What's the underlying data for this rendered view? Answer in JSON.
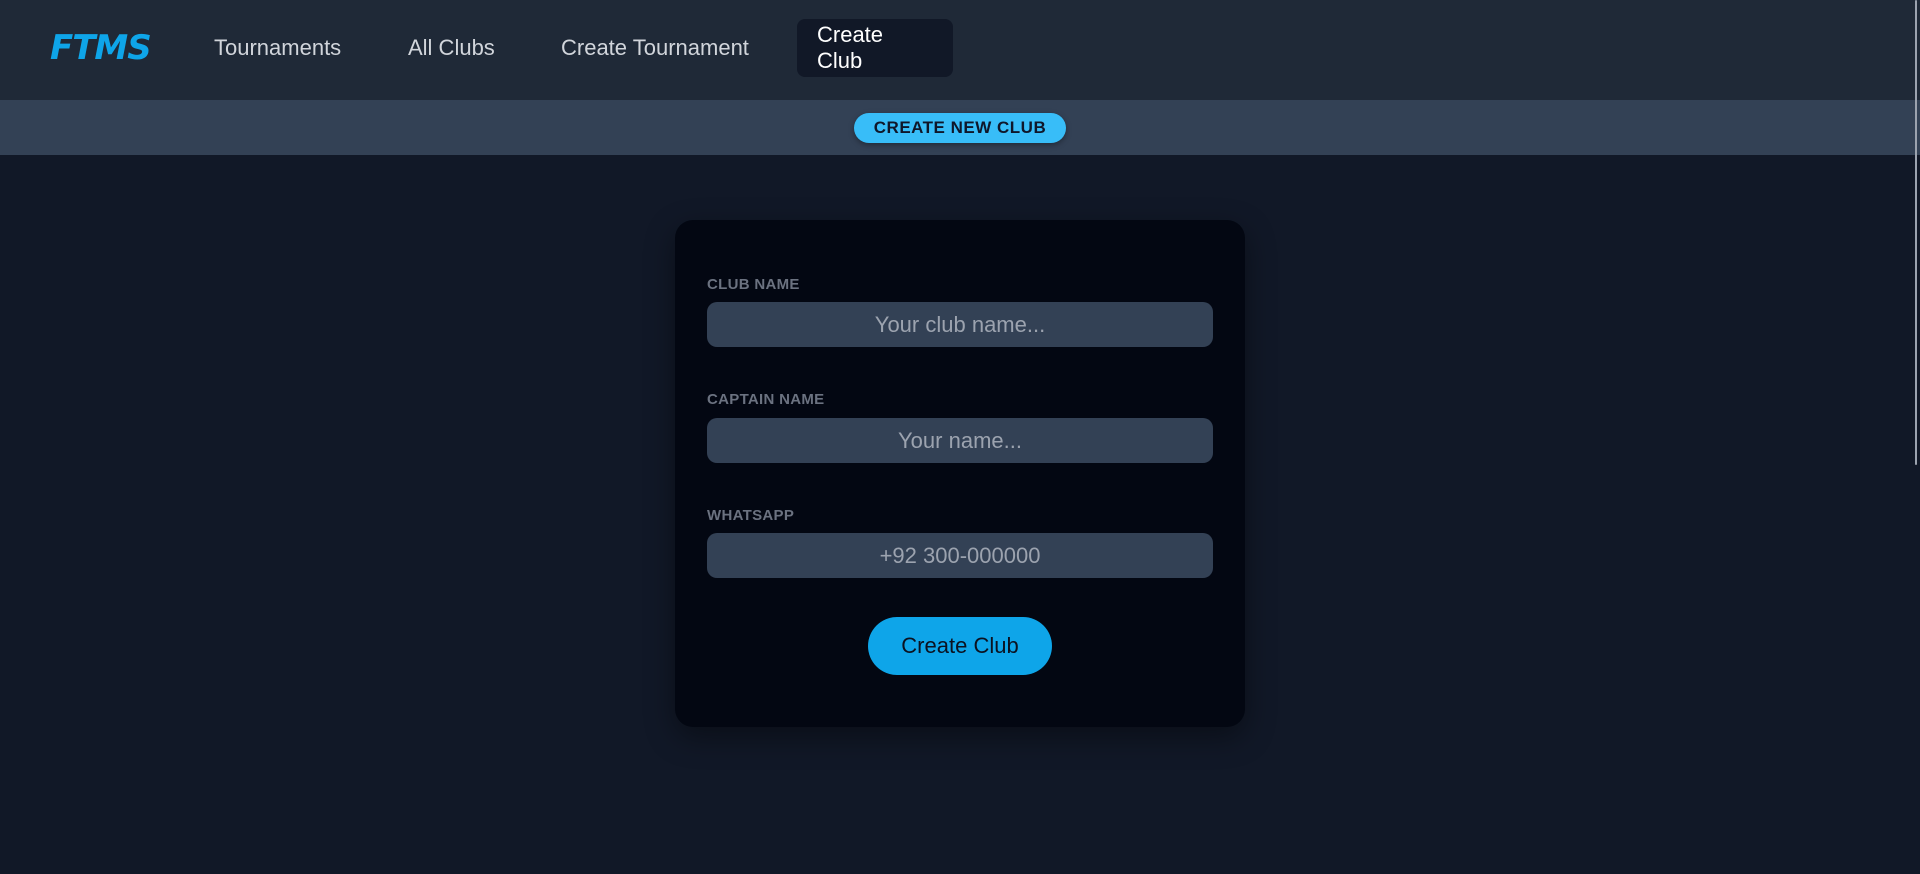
{
  "navbar": {
    "logo": "FTMS",
    "links": [
      {
        "label": "Tournaments"
      },
      {
        "label": "All Clubs"
      },
      {
        "label": "Create Tournament"
      },
      {
        "label": "Create Club",
        "active": true
      }
    ]
  },
  "subbar": {
    "title": "CREATE NEW CLUB"
  },
  "form": {
    "club_name": {
      "label": "CLUB NAME",
      "placeholder": "Your club name...",
      "value": ""
    },
    "captain_name": {
      "label": "CAPTAIN NAME",
      "placeholder": "Your name...",
      "value": ""
    },
    "whatsapp": {
      "label": "WHATSAPP",
      "placeholder": "+92 300-000000",
      "value": ""
    },
    "submit_label": "Create Club"
  },
  "colors": {
    "accent": "#0ea5e9",
    "pill": "#38bdf8",
    "background": "#111827",
    "navbar": "#1f2937",
    "card": "#030712",
    "input": "#334155"
  }
}
